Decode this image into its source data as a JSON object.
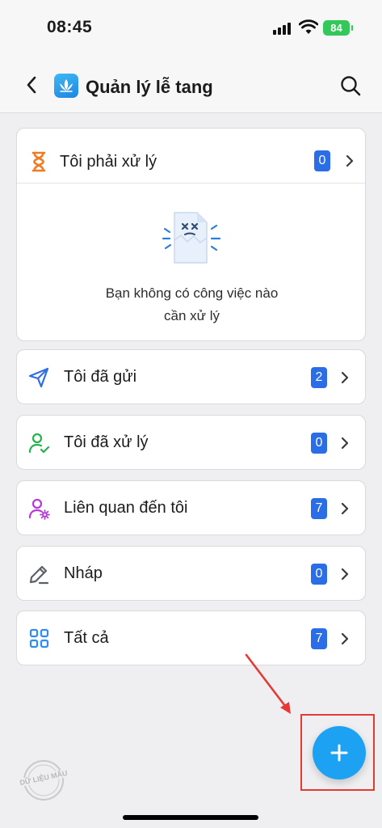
{
  "status_bar": {
    "time": "08:45",
    "battery": "84"
  },
  "header": {
    "title": "Quản lý lễ tang",
    "back_icon": "chevron-left-icon",
    "search_icon": "search-icon"
  },
  "todo": {
    "label": "Tôi phải xử lý",
    "count": "0",
    "icon": "hourglass-icon",
    "empty_line1": "Bạn không có công việc nào",
    "empty_line2": "cần xử lý"
  },
  "rows": [
    {
      "label": "Tôi đã gửi",
      "count": "2",
      "icon": "send-icon"
    },
    {
      "label": "Tôi đã xử lý",
      "count": "0",
      "icon": "user-check-icon"
    },
    {
      "label": "Liên quan đến tôi",
      "count": "7",
      "icon": "user-gear-icon"
    },
    {
      "label": "Nháp",
      "count": "0",
      "icon": "pencil-icon"
    },
    {
      "label": "Tất cả",
      "count": "7",
      "icon": "grid-icon"
    }
  ],
  "fab": {
    "icon": "plus-icon"
  },
  "watermark": "DỮ LIỆU MẪU",
  "colors": {
    "accent": "#1da1f2",
    "badge": "#2a6de6",
    "highlight": "#e53935"
  }
}
